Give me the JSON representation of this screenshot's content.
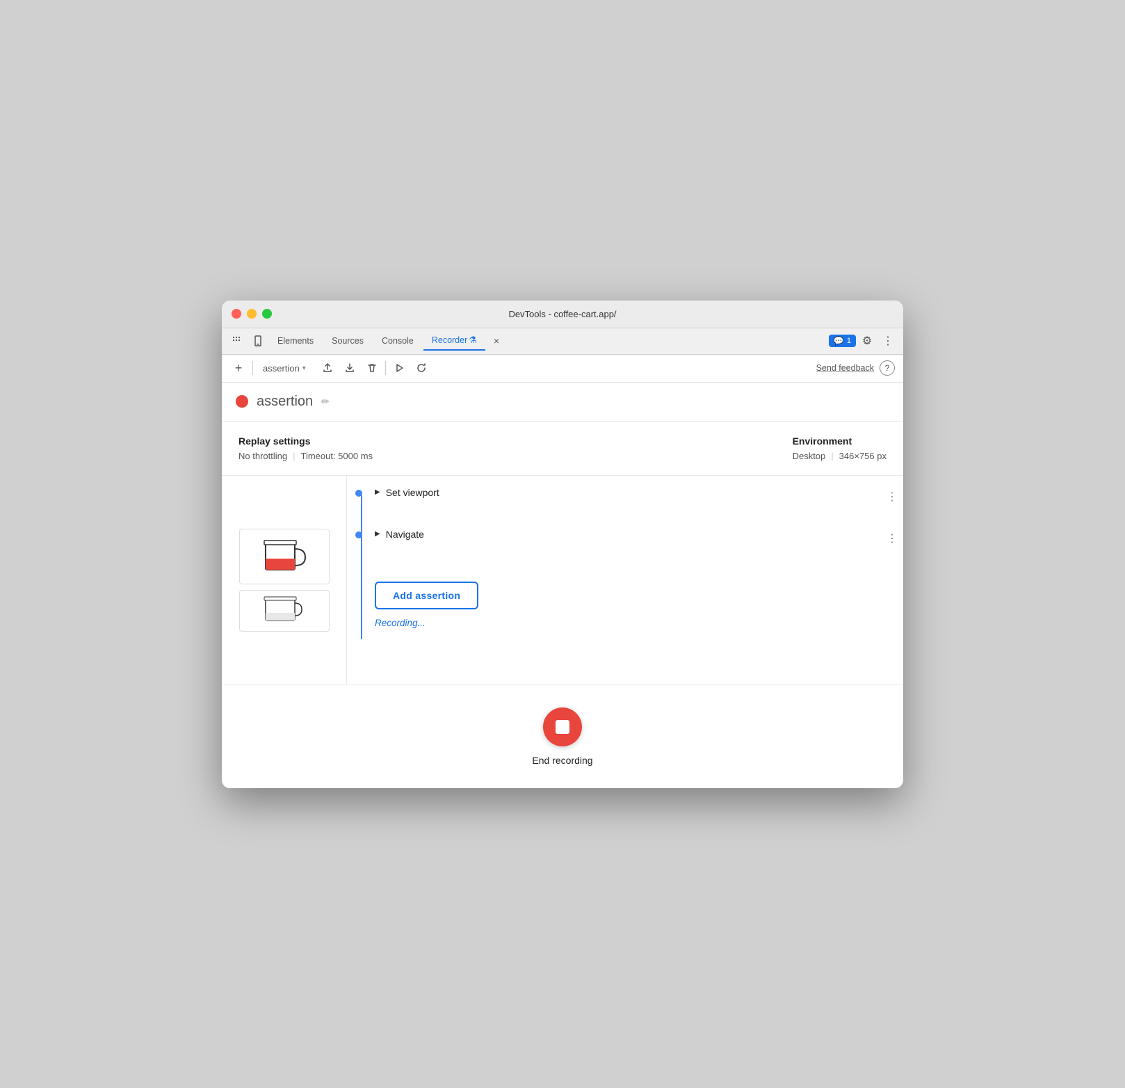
{
  "window": {
    "title": "DevTools - coffee-cart.app/"
  },
  "tabs": {
    "items": [
      {
        "id": "elements",
        "label": "Elements",
        "active": false
      },
      {
        "id": "sources",
        "label": "Sources",
        "active": false
      },
      {
        "id": "console",
        "label": "Console",
        "active": false
      },
      {
        "id": "recorder",
        "label": "Recorder",
        "active": true
      }
    ],
    "close_label": "×",
    "more_label": "»",
    "badge_count": "1"
  },
  "toolbar": {
    "add_label": "+",
    "dropdown_value": "assertion",
    "feedback_label": "Send feedback",
    "help_label": "?"
  },
  "recording": {
    "name": "assertion",
    "dot_color": "#e8453c"
  },
  "replay_settings": {
    "title": "Replay settings",
    "throttling": "No throttling",
    "timeout": "Timeout: 5000 ms"
  },
  "environment": {
    "title": "Environment",
    "preset": "Desktop",
    "dimensions": "346×756 px"
  },
  "steps": [
    {
      "id": "set-viewport",
      "label": "Set viewport",
      "expanded": false
    },
    {
      "id": "navigate",
      "label": "Navigate",
      "expanded": false
    }
  ],
  "add_assertion": {
    "button_label": "Add assertion",
    "status_label": "Recording..."
  },
  "end_recording": {
    "label": "End recording"
  },
  "icons": {
    "upload": "↑",
    "download": "↓",
    "delete": "🗑",
    "play": "▶",
    "replay": "↺",
    "edit": "✏",
    "dots_vertical": "⋮",
    "chevron_down": "▾",
    "triangle_right": "▶"
  }
}
